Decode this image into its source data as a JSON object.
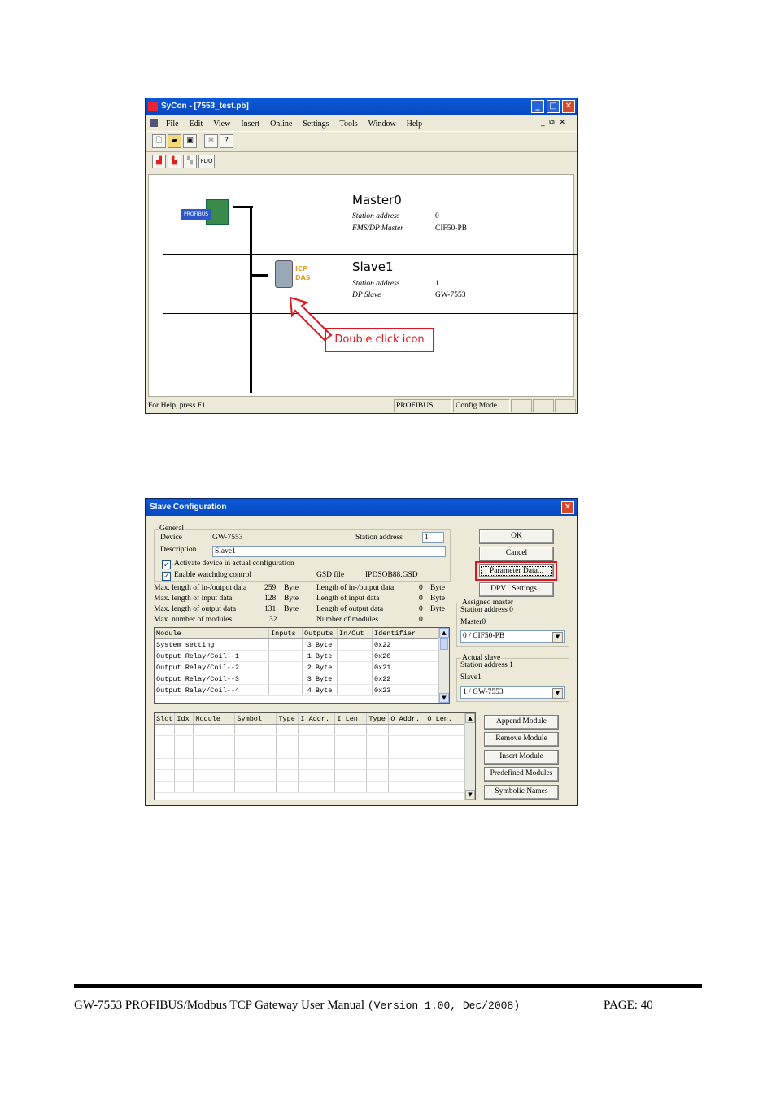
{
  "sycon_window": {
    "title": "SyCon - [7553_test.pb]",
    "menu": [
      "File",
      "Edit",
      "View",
      "Insert",
      "Online",
      "Settings",
      "Tools",
      "Window",
      "Help"
    ],
    "toolbar2_fdo_label": "FDO",
    "master": {
      "name": "Master0",
      "station_address_label": "Station address",
      "station_address_value": "0",
      "type_label": "FMS/DP Master",
      "type_value": "CIF50-PB"
    },
    "slave": {
      "name": "Slave1",
      "station_address_label": "Station address",
      "station_address_value": "1",
      "type_label": "DP Slave",
      "type_value": "GW-7553"
    },
    "callout": "Double click icon",
    "status": {
      "help": "For Help, press F1",
      "protocol": "PROFIBUS",
      "mode": "Config Mode"
    }
  },
  "slave_config_dialog": {
    "title": "Slave Configuration",
    "general": {
      "group_label": "General",
      "device_label": "Device",
      "device_value": "GW-7553",
      "station_address_label": "Station address",
      "station_address_value": "1",
      "description_label": "Description",
      "description_value": "Slave1",
      "activate_label": "Activate device in actual configuration",
      "watchdog_label": "Enable watchdog control",
      "gsd_label": "GSD file",
      "gsd_value": "IPDSOB88.GSD"
    },
    "stats_left": [
      {
        "label": "Max. length of in-/output data",
        "value": "259",
        "unit": "Byte"
      },
      {
        "label": "Max. length of input data",
        "value": "128",
        "unit": "Byte"
      },
      {
        "label": "Max. length of output data",
        "value": "131",
        "unit": "Byte"
      },
      {
        "label": "Max. number of modules",
        "value": "32",
        "unit": ""
      }
    ],
    "stats_right": [
      {
        "label": "Length of in-/output data",
        "value": "0",
        "unit": "Byte"
      },
      {
        "label": "Length of input data",
        "value": "0",
        "unit": "Byte"
      },
      {
        "label": "Length of output data",
        "value": "0",
        "unit": "Byte"
      },
      {
        "label": "Number of modules",
        "value": "0",
        "unit": ""
      }
    ],
    "module_table": {
      "headers": [
        "Module",
        "Inputs",
        "Outputs",
        "In/Out",
        "Identifier"
      ],
      "rows": [
        [
          "System setting",
          "",
          "3 Byte",
          "",
          "0x22"
        ],
        [
          "Output Relay/Coil--1",
          "",
          "1 Byte",
          "",
          "0x20"
        ],
        [
          "Output Relay/Coil--2",
          "",
          "2 Byte",
          "",
          "0x21"
        ],
        [
          "Output Relay/Coil--3",
          "",
          "3 Byte",
          "",
          "0x22"
        ],
        [
          "Output Relay/Coil--4",
          "",
          "4 Byte",
          "",
          "0x23"
        ]
      ]
    },
    "slot_table": {
      "headers": [
        "Slot",
        "Idx",
        "Module",
        "Symbol",
        "Type",
        "I Addr.",
        "I Len.",
        "Type",
        "O Addr.",
        "O Len."
      ]
    },
    "buttons": {
      "ok": "OK",
      "cancel": "Cancel",
      "parameter_data": "Parameter Data...",
      "dpv1_settings": "DPV1 Settings...",
      "append_module": "Append Module",
      "remove_module": "Remove Module",
      "insert_module": "Insert Module",
      "predefined_modules": "Predefined Modules",
      "symbolic_names": "Symbolic Names"
    },
    "assigned_master": {
      "group_label": "Assigned master",
      "station_address": "Station address 0",
      "name": "Master0",
      "selected": "0 / CIF50-PB"
    },
    "actual_slave": {
      "group_label": "Actual slave",
      "station_address": "Station address 1",
      "name": "Slave1",
      "selected": "1 / GW-7553"
    }
  },
  "footer": {
    "manual_title": "GW-7553 PROFIBUS/Modbus TCP Gateway User Manual",
    "version": "(Version 1.00, Dec/2008)",
    "page": "PAGE: 40"
  },
  "colors": {
    "titlebar_blue": "#0a5ad8",
    "highlight_red": "#e0141e",
    "window_bg": "#ece9d8"
  }
}
